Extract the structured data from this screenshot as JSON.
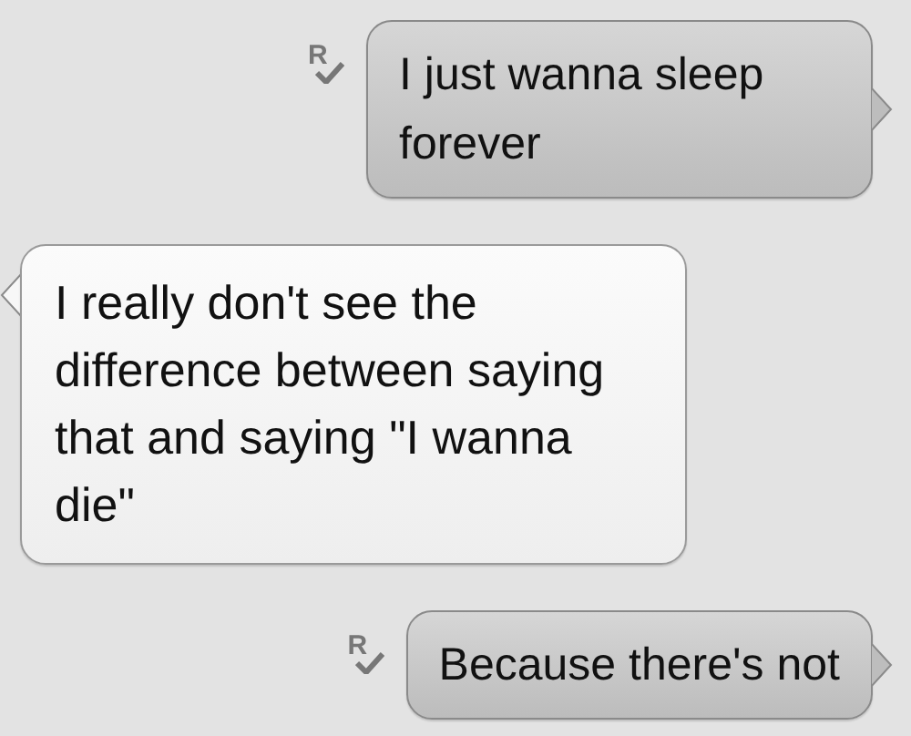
{
  "messages": [
    {
      "kind": "outgoing",
      "text": "I just wanna sleep forever",
      "status": "R",
      "read": true
    },
    {
      "kind": "incoming",
      "text": "I really don't see the difference between saying that and saying \"I wanna die\""
    },
    {
      "kind": "outgoing",
      "text": "Because there's not",
      "status": "R",
      "read": true
    }
  ]
}
